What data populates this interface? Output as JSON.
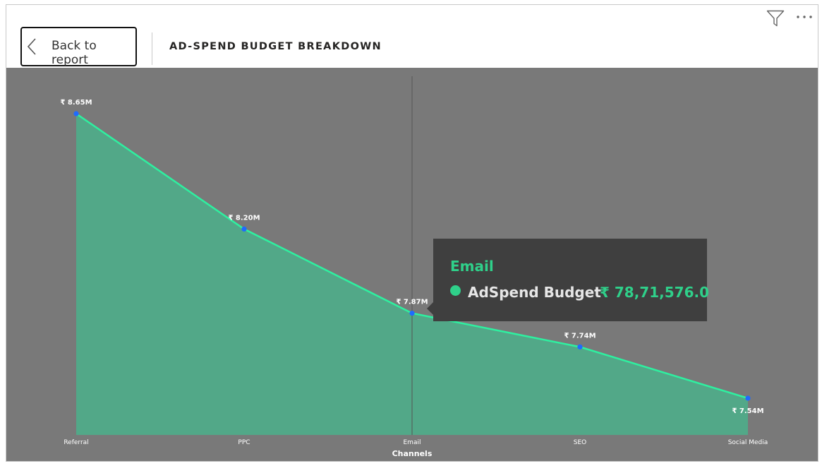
{
  "header": {
    "back_label": "Back to report",
    "title": "AD-SPEND BUDGET BREAKDOWN"
  },
  "toolbar": {
    "filter_icon": "filter-icon",
    "more_icon": "more-options-icon"
  },
  "colors": {
    "plot_background": "#797979",
    "area_fill": "#52a888",
    "line": "#2ef0a0",
    "marker": "#1e6bff",
    "tooltip_background": "#3f3f3f",
    "tooltip_accent": "#2fd08a"
  },
  "tooltip": {
    "category": "Email",
    "series": "AdSpend Budget",
    "value": "₹ 78,71,576.0"
  },
  "chart_data": {
    "type": "area",
    "title": "",
    "xlabel": "Channels",
    "ylabel": "",
    "categories": [
      "Referral",
      "PPC",
      "Email",
      "SEO",
      "Social Media"
    ],
    "series": [
      {
        "name": "AdSpend Budget",
        "values": [
          8650000,
          8200000,
          7871576,
          7740000,
          7540000
        ],
        "labels": [
          "₹ 8.65M",
          "₹ 8.20M",
          "₹ 7.87M",
          "₹ 7.74M",
          "₹ 7.54M"
        ]
      }
    ],
    "highlighted_category": "Email",
    "grid": false,
    "legend": "none"
  }
}
